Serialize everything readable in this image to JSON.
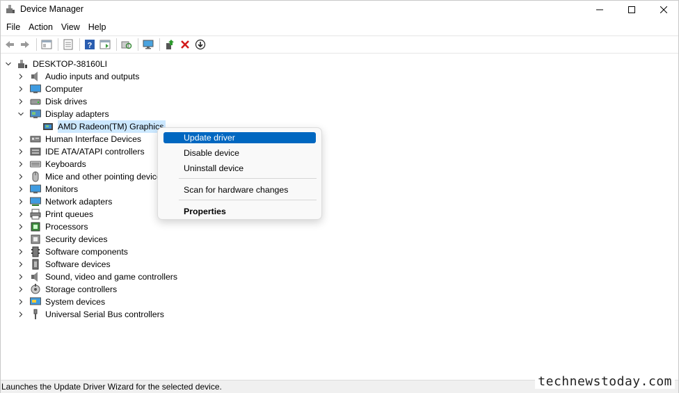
{
  "window": {
    "title": "Device Manager"
  },
  "menu": [
    "File",
    "Action",
    "View",
    "Help"
  ],
  "toolbar": {
    "buttons": [
      "back-icon",
      "forward-icon",
      "show-hide-console-tree-icon",
      "properties-icon",
      "help-icon",
      "action-pane-icon",
      "scan-hardware-icon",
      "monitor-icon",
      "update-driver-icon",
      "uninstall-icon",
      "download-icon"
    ]
  },
  "tree": {
    "root": "DESKTOP-38160LI",
    "categories": [
      {
        "label": "Audio inputs and outputs",
        "icon": "speaker-icon"
      },
      {
        "label": "Computer",
        "icon": "computer-icon"
      },
      {
        "label": "Disk drives",
        "icon": "disk-drive-icon"
      },
      {
        "label": "Display adapters",
        "icon": "display-adapter-icon",
        "expanded": true
      },
      {
        "label": "Human Interface Devices",
        "icon": "hid-icon"
      },
      {
        "label": "IDE ATA/ATAPI controllers",
        "icon": "ide-controller-icon"
      },
      {
        "label": "Keyboards",
        "icon": "keyboard-icon"
      },
      {
        "label": "Mice and other pointing devices",
        "icon": "mouse-icon"
      },
      {
        "label": "Monitors",
        "icon": "monitor-icon"
      },
      {
        "label": "Network adapters",
        "icon": "network-adapter-icon"
      },
      {
        "label": "Print queues",
        "icon": "printer-icon"
      },
      {
        "label": "Processors",
        "icon": "processor-icon"
      },
      {
        "label": "Security devices",
        "icon": "security-device-icon"
      },
      {
        "label": "Software components",
        "icon": "software-component-icon"
      },
      {
        "label": "Software devices",
        "icon": "software-device-icon"
      },
      {
        "label": "Sound, video and game controllers",
        "icon": "sound-icon"
      },
      {
        "label": "Storage controllers",
        "icon": "storage-controller-icon"
      },
      {
        "label": "System devices",
        "icon": "system-device-icon"
      },
      {
        "label": "Universal Serial Bus controllers",
        "icon": "usb-icon"
      }
    ],
    "display_child": "AMD Radeon(TM) Graphics"
  },
  "context_menu": {
    "update_driver": "Update driver",
    "disable_device": "Disable device",
    "uninstall_device": "Uninstall device",
    "scan": "Scan for hardware changes",
    "properties": "Properties"
  },
  "status": {
    "text": "Launches the Update Driver Wizard for the selected device."
  },
  "watermark": "technewstoday.com",
  "colors": {
    "selection": "#cce8ff",
    "menu_highlight": "#0067c0"
  }
}
